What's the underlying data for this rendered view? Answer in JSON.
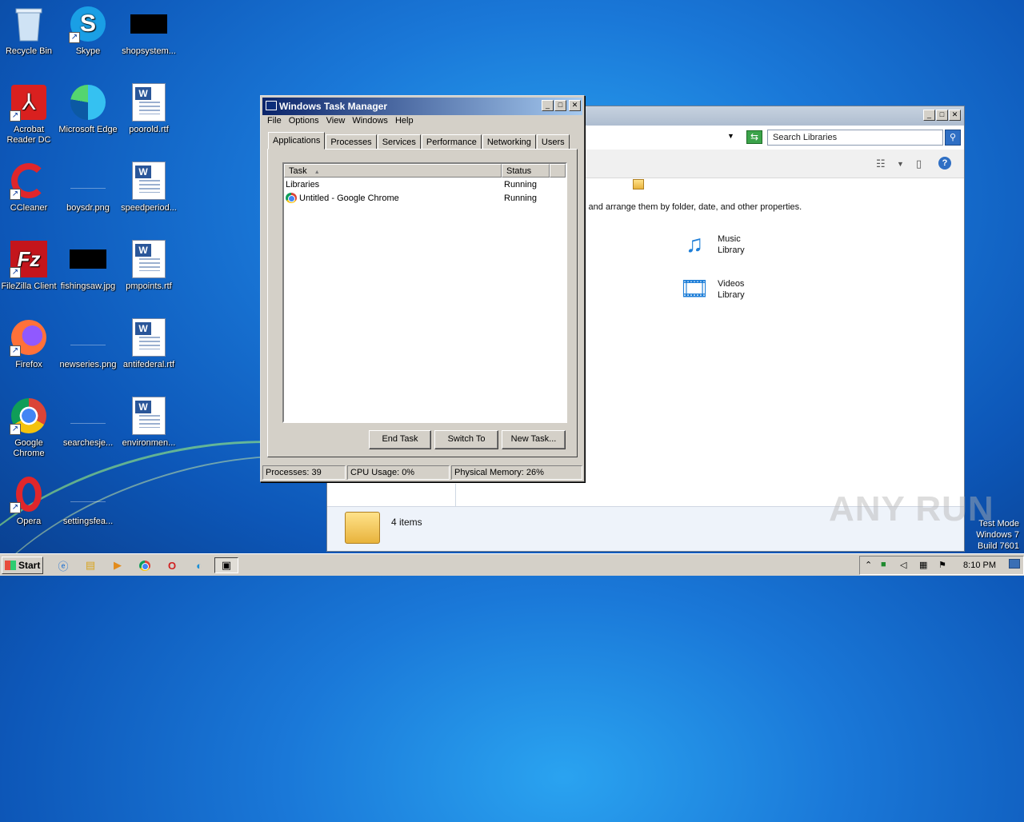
{
  "desktop": {
    "icons": [
      {
        "label": "Recycle Bin"
      },
      {
        "label": "Skype"
      },
      {
        "label": "shopsystem..."
      },
      {
        "label": "Acrobat Reader DC"
      },
      {
        "label": "Microsoft Edge"
      },
      {
        "label": "poorold.rtf"
      },
      {
        "label": "CCleaner"
      },
      {
        "label": "boysdr.png"
      },
      {
        "label": "speedperiod..."
      },
      {
        "label": "FileZilla Client"
      },
      {
        "label": "fishingsaw.jpg"
      },
      {
        "label": "pmpoints.rtf"
      },
      {
        "label": "Firefox"
      },
      {
        "label": "newseries.png"
      },
      {
        "label": "antifederal.rtf"
      },
      {
        "label": "Google Chrome"
      },
      {
        "label": "searchesje..."
      },
      {
        "label": "environmen..."
      },
      {
        "label": "Opera"
      },
      {
        "label": "settingsfea..."
      }
    ],
    "watermark": {
      "line1": "Test Mode",
      "line2": "Windows 7",
      "line3": "Build 7601"
    },
    "brand": "ANY RUN"
  },
  "explorer": {
    "search_placeholder": "Search Libraries",
    "description": "s and arrange them by folder, date, and other properties.",
    "libraries": [
      {
        "line1": "Music",
        "line2": "Library"
      },
      {
        "line1": "Videos",
        "line2": "Library"
      }
    ],
    "item_count": "4 items"
  },
  "task_manager": {
    "title": "Windows Task Manager",
    "menu": [
      "File",
      "Options",
      "View",
      "Windows",
      "Help"
    ],
    "tabs": [
      "Applications",
      "Processes",
      "Services",
      "Performance",
      "Networking",
      "Users"
    ],
    "active_tab": "Applications",
    "columns": {
      "task": "Task",
      "status": "Status"
    },
    "rows": [
      {
        "task": "Libraries",
        "status": "Running"
      },
      {
        "task": "Untitled - Google Chrome",
        "status": "Running"
      }
    ],
    "buttons": {
      "end_task": "End Task",
      "switch_to": "Switch To",
      "new_task": "New Task..."
    },
    "status_bar": {
      "processes": "Processes: 39",
      "cpu": "CPU Usage: 0%",
      "memory": "Physical Memory: 26%"
    }
  },
  "taskbar": {
    "start_label": "Start",
    "clock": "8:10 PM"
  },
  "colors": {
    "accent": "#0a246a",
    "desktop": "#1a78d8"
  }
}
